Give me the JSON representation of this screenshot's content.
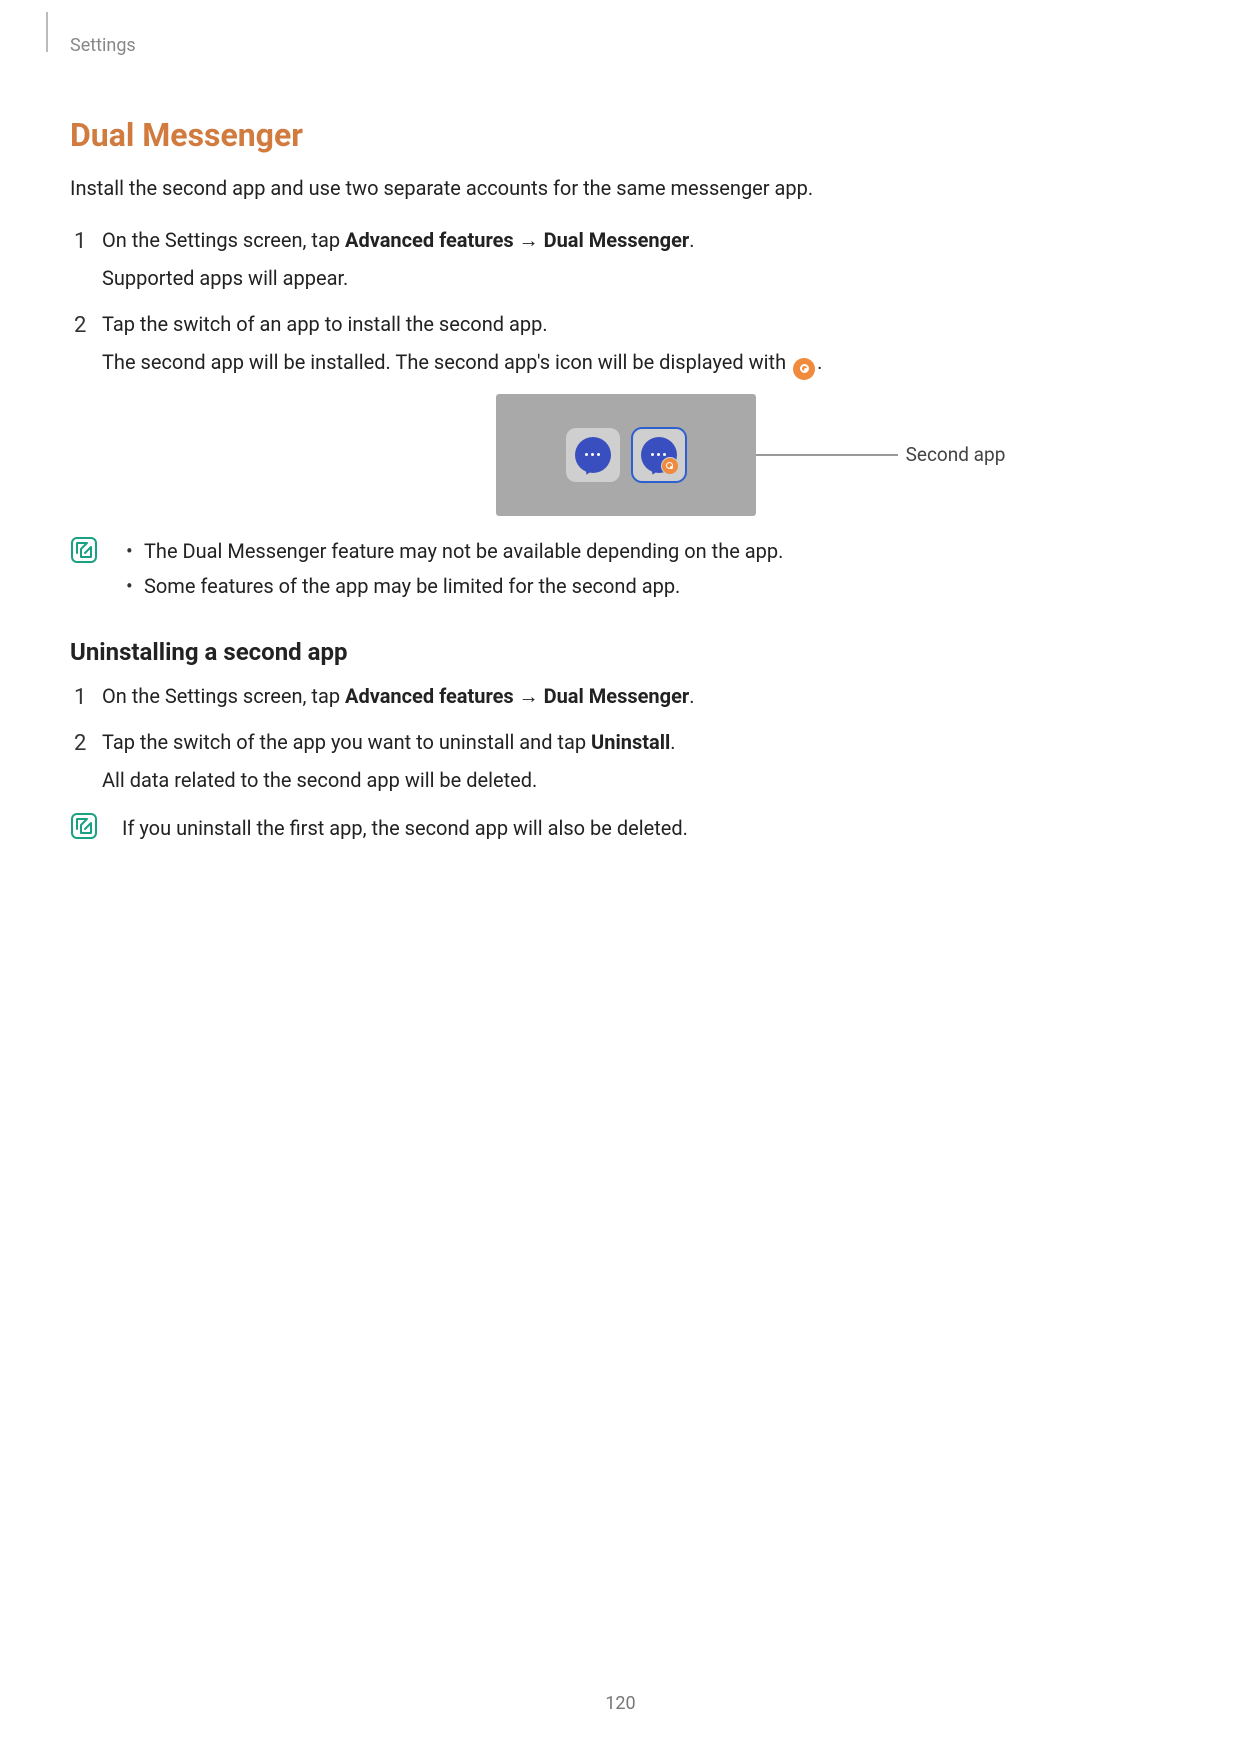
{
  "header": {
    "breadcrumb": "Settings"
  },
  "section": {
    "title": "Dual Messenger",
    "intro": "Install the second app and use two separate accounts for the same messenger app."
  },
  "steps1": [
    {
      "prefix": "On the Settings screen, tap ",
      "bold1": "Advanced features",
      "arrow": " → ",
      "bold2": "Dual Messenger",
      "suffix": ".",
      "sub": "Supported apps will appear."
    },
    {
      "line": "Tap the switch of an app to install the second app.",
      "sub_prefix": "The second app will be installed. The second app's icon will be displayed with ",
      "sub_suffix": "."
    }
  ],
  "figure": {
    "callout": "Second app"
  },
  "notes1": [
    "The Dual Messenger feature may not be available depending on the app.",
    "Some features of the app may be limited for the second app."
  ],
  "subheading": "Uninstalling a second app",
  "steps2": [
    {
      "prefix": "On the Settings screen, tap ",
      "bold1": "Advanced features",
      "arrow": " → ",
      "bold2": "Dual Messenger",
      "suffix": "."
    },
    {
      "prefix": "Tap the switch of the app you want to uninstall and tap ",
      "bold1": "Uninstall",
      "suffix": ".",
      "sub": "All data related to the second app will be deleted."
    }
  ],
  "note2": "If you uninstall the first app, the second app will also be deleted.",
  "page_number": "120"
}
